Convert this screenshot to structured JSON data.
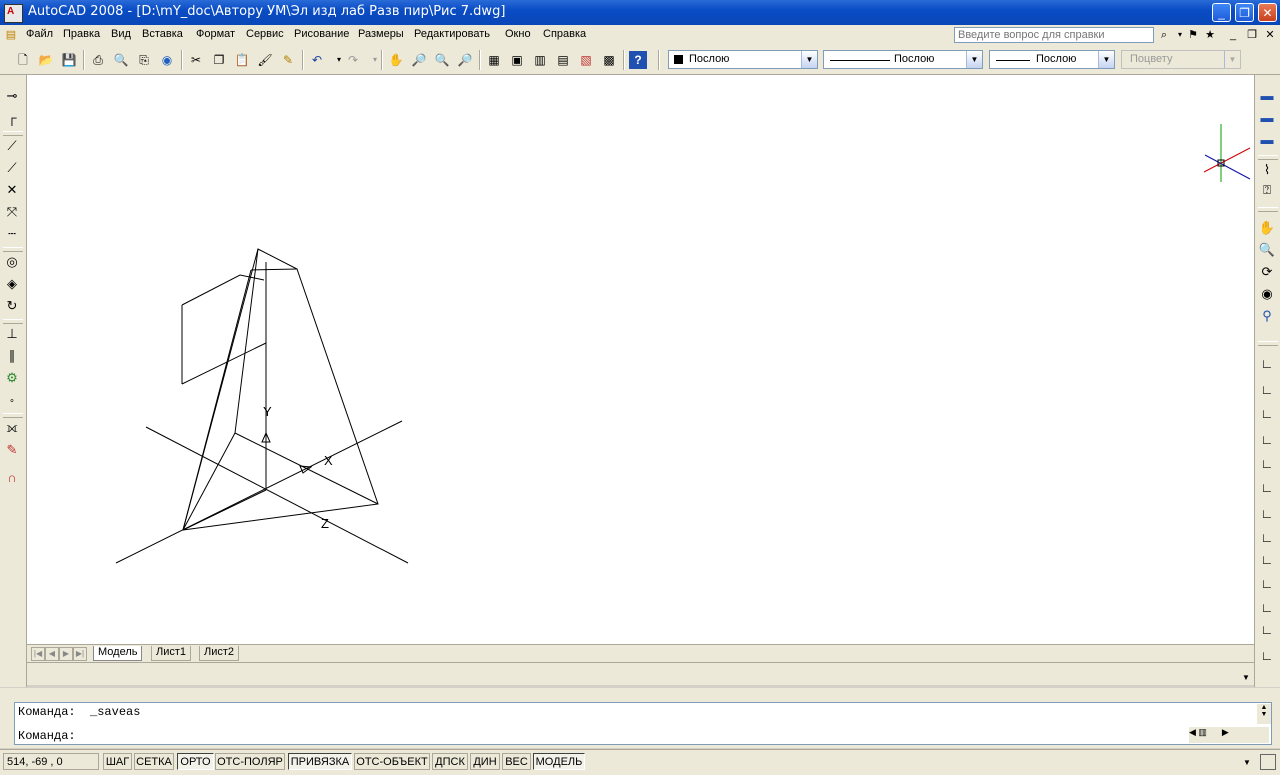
{
  "window": {
    "title": "AutoCAD 2008 - [D:\\mY_doc\\Автору УМ\\Эл изд лаб Разв пир\\Рис 7.dwg]",
    "logo_text": "A",
    "minimize": "_",
    "restore": "❐",
    "close": "✕"
  },
  "menu": {
    "items": [
      "Файл",
      "Правка",
      "Вид",
      "Вставка",
      "Формат",
      "Сервис",
      "Рисование",
      "Размеры",
      "Редактировать",
      "Окно",
      "Справка"
    ],
    "help_placeholder": "Введите вопрос для справки"
  },
  "toolbar": {
    "color_combo": "Послою",
    "linetype_combo": "Послою",
    "lineweight_combo": "Послою",
    "plotstyle_combo": "Поцвету"
  },
  "drawing": {
    "axis_x_label": "X",
    "axis_y_label": "Y",
    "axis_z_label": "Z"
  },
  "tabs": [
    "Модель",
    "Лист1",
    "Лист2"
  ],
  "command": {
    "line1": "Команда:  _saveas",
    "line2": "Команда:"
  },
  "status": {
    "coords": "514, -69 , 0",
    "buttons": [
      "ШАГ",
      "СЕТКА",
      "ОРТО",
      "ОТС-ПОЛЯР",
      "ПРИВЯЗКА",
      "ОТС-ОБЪЕКТ",
      "ДПСК",
      "ДИН",
      "ВЕС",
      "МОДЕЛЬ"
    ],
    "on_states": [
      false,
      false,
      true,
      false,
      true,
      false,
      false,
      false,
      false,
      true
    ]
  },
  "colors": {
    "titlebar": "#0a4cc4",
    "ucs_x": "#cc0000",
    "ucs_y": "#00a000"
  }
}
